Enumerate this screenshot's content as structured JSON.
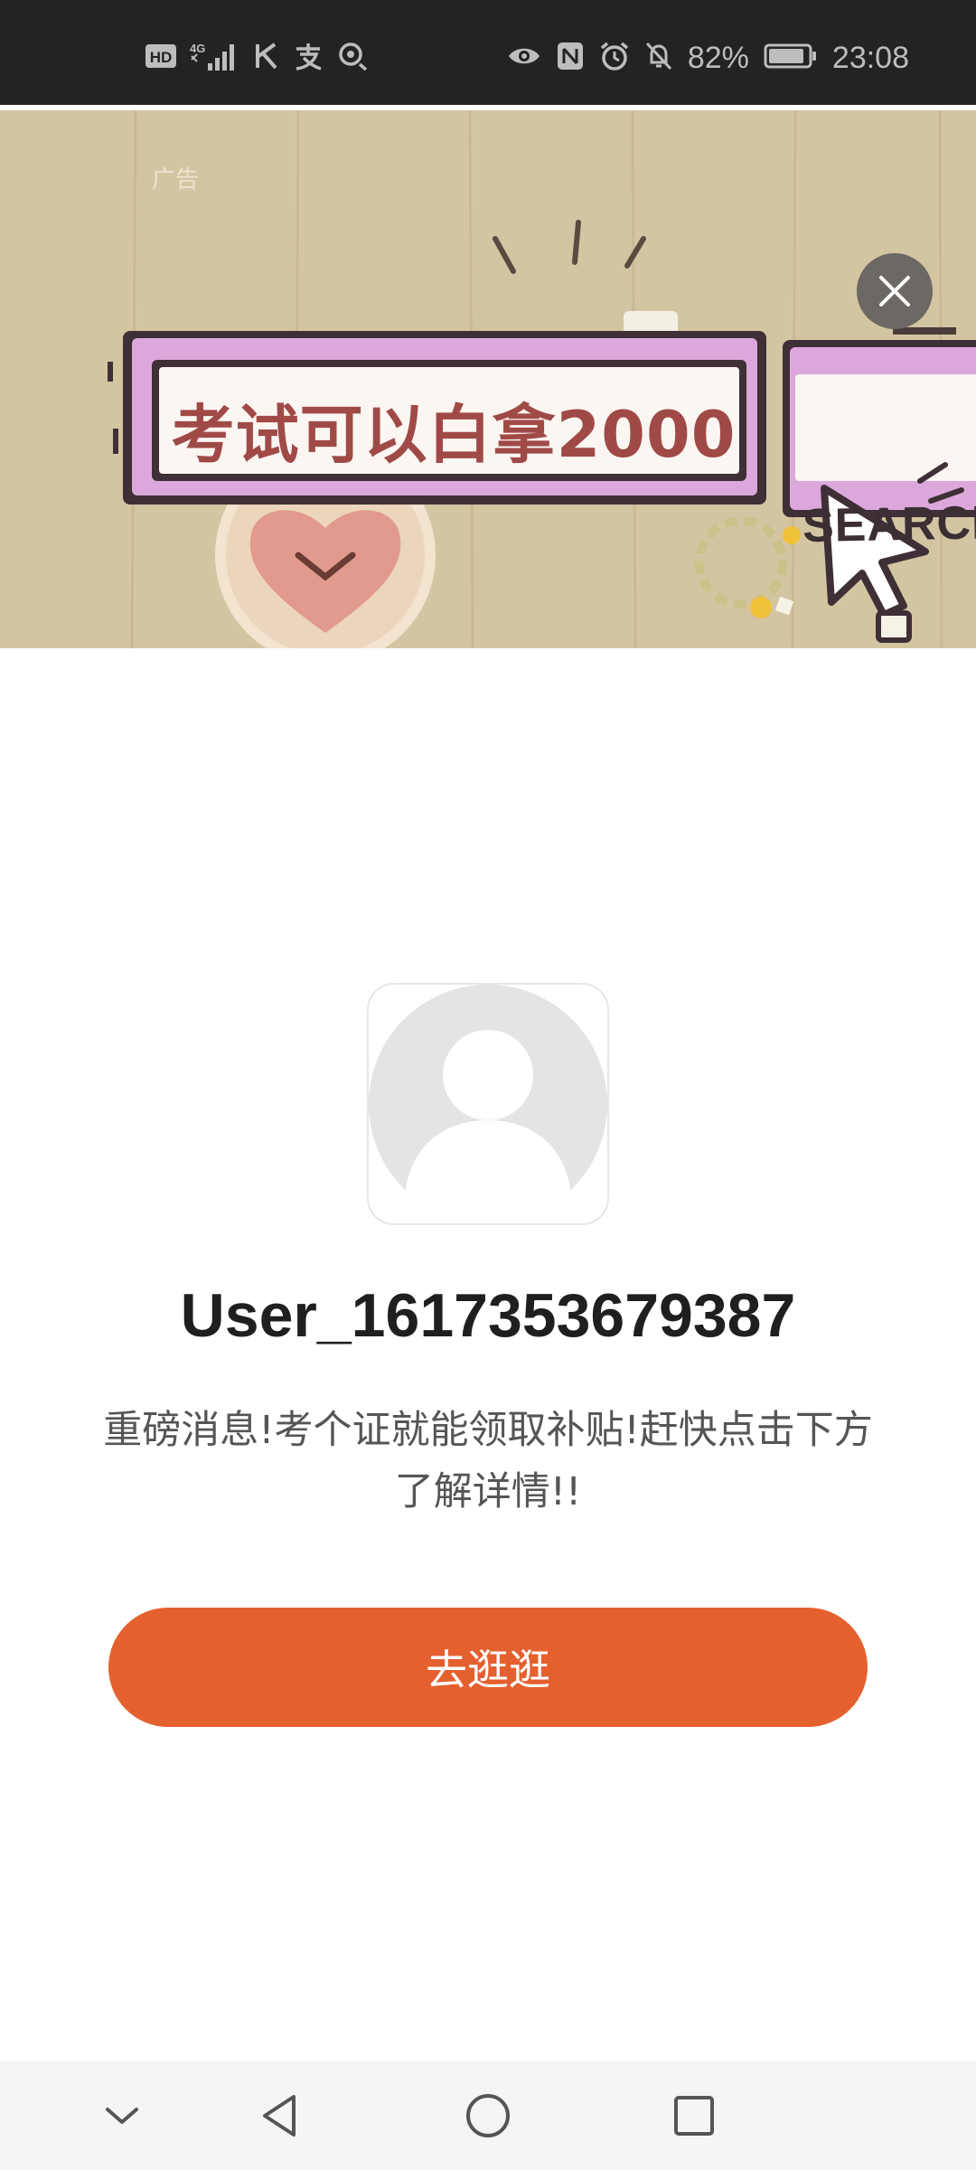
{
  "status_bar": {
    "network_hd": "HD",
    "network_gen": "4G",
    "battery_percent": "82%",
    "time": "23:08"
  },
  "ad": {
    "label": "广告",
    "headline": "考试可以白拿2000",
    "search_word": "SEARCH",
    "colors": {
      "background": "#d4c5a2",
      "frame": "#dca8dc",
      "text": "#a04a48"
    }
  },
  "profile": {
    "username": "User_1617353679387",
    "message": "重磅消息!考个证就能领取补贴!赶快点击下方了解详情!!",
    "cta_label": "去逛逛",
    "cta_color": "#e5602f"
  },
  "nav_icons": [
    "chevron-down-icon",
    "back-icon",
    "home-icon",
    "recents-icon"
  ]
}
